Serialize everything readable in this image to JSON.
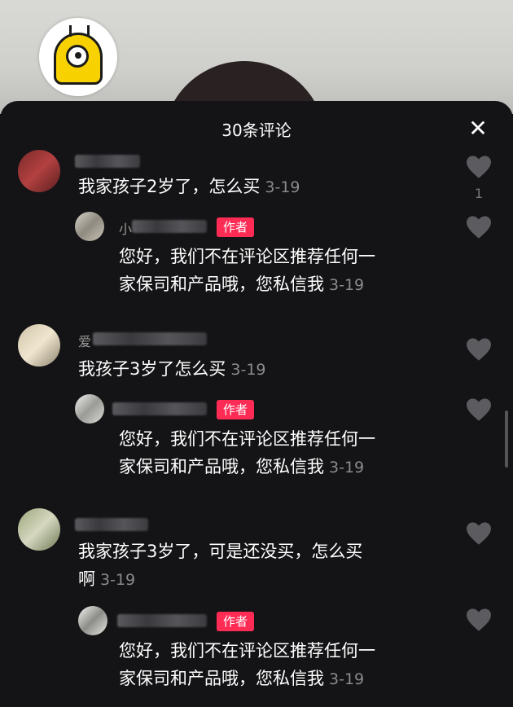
{
  "header": {
    "title": "30条评论",
    "close_icon": "close-icon"
  },
  "colors": {
    "author_tag": "#fe2c55",
    "sheet_bg": "#141416",
    "date_gray": "#8a8a8a"
  },
  "comments": [
    {
      "text": "我家孩子2岁了，怎么买",
      "date": "3-19",
      "like_count": "1",
      "reply": {
        "name_prefix": "小",
        "author_tag": "作者",
        "line1": "您好，我们不在评论区推荐任何一",
        "line2": "家保司和产品哦，您私信我",
        "date": "3-19"
      }
    },
    {
      "name_prefix": "爱",
      "text": "我孩子3岁了怎么买",
      "date": "3-19",
      "reply": {
        "author_tag": "作者",
        "line1": "您好，我们不在评论区推荐任何一",
        "line2": "家保司和产品哦，您私信我",
        "date": "3-19"
      }
    },
    {
      "line1": "我家孩子3岁了，可是还没买，怎么买",
      "line2": "啊",
      "date": "3-19",
      "reply": {
        "author_tag": "作者",
        "line1": "您好，我们不在评论区推荐任何一",
        "line2": "家保司和产品哦，您私信我",
        "date": "3-19"
      }
    }
  ]
}
